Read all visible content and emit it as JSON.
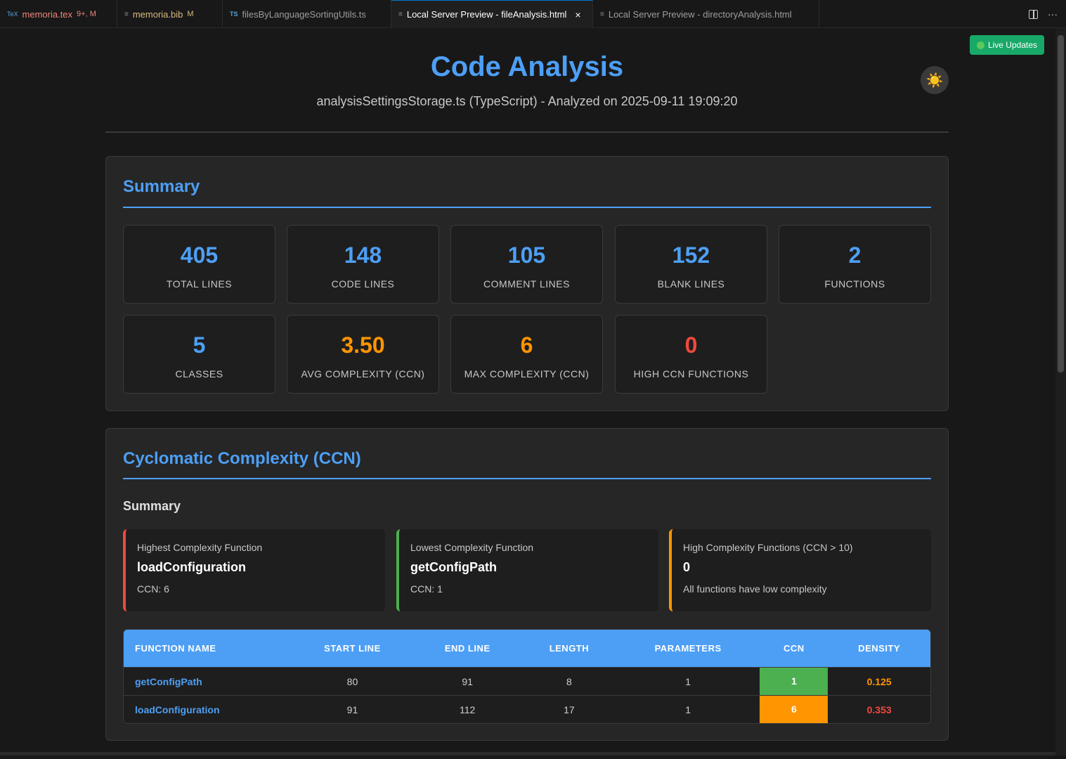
{
  "tabs": [
    {
      "icon": "TeX",
      "name": "memoria.tex",
      "modifier": "9+, M"
    },
    {
      "icon": "≡",
      "name": "memoria.bib",
      "modifier": "M"
    },
    {
      "icon": "TS",
      "name": "filesByLanguageSortingUtils.ts"
    },
    {
      "icon": "≡",
      "name": "Local Server Preview - fileAnalysis.html",
      "close": "×"
    },
    {
      "icon": "≡",
      "name": "Local Server Preview - directoryAnalysis.html"
    }
  ],
  "tab_actions": {
    "more": "···"
  },
  "live_updates": {
    "label": "Live Updates",
    "dot_color": "#5cc95c"
  },
  "theme_toggle": {
    "glyph": "☀️"
  },
  "header": {
    "title": "Code Analysis",
    "subtitle": "analysisSettingsStorage.ts (TypeScript) - Analyzed on 2025-09-11 19:09:20"
  },
  "summary": {
    "title": "Summary",
    "stats": [
      {
        "value": "405",
        "label": "TOTAL LINES",
        "color": "#4d9ff5"
      },
      {
        "value": "148",
        "label": "CODE LINES",
        "color": "#4d9ff5"
      },
      {
        "value": "105",
        "label": "COMMENT LINES",
        "color": "#4d9ff5"
      },
      {
        "value": "152",
        "label": "BLANK LINES",
        "color": "#4d9ff5"
      },
      {
        "value": "2",
        "label": "FUNCTIONS",
        "color": "#4d9ff5"
      },
      {
        "value": "5",
        "label": "CLASSES",
        "color": "#4d9ff5"
      },
      {
        "value": "3.50",
        "label": "AVG COMPLEXITY (CCN)",
        "color": "#ff9500"
      },
      {
        "value": "6",
        "label": "MAX COMPLEXITY (CCN)",
        "color": "#ff9500"
      },
      {
        "value": "0",
        "label": "HIGH CCN FUNCTIONS",
        "color": "#f0483e"
      }
    ]
  },
  "ccn": {
    "title": "Cyclomatic Complexity (CCN)",
    "summary_title": "Summary",
    "cards": [
      {
        "label": "Highest Complexity Function",
        "value": "loadConfiguration",
        "sub": "CCN: 6",
        "border": "#f0483e"
      },
      {
        "label": "Lowest Complexity Function",
        "value": "getConfigPath",
        "sub": "CCN: 1",
        "border": "#4caf50"
      },
      {
        "label": "High Complexity Functions (CCN > 10)",
        "value": "0",
        "sub": "All functions have low complexity",
        "border": "#ff9500"
      }
    ],
    "table": {
      "headers": [
        "FUNCTION NAME",
        "START LINE",
        "END LINE",
        "LENGTH",
        "PARAMETERS",
        "CCN",
        "DENSITY"
      ],
      "rows": [
        {
          "name": "getConfigPath",
          "start": "80",
          "end": "91",
          "length": "8",
          "params": "1",
          "ccn": "1",
          "density": "0.125",
          "ccn_color": "#4caf50"
        },
        {
          "name": "loadConfiguration",
          "start": "91",
          "end": "112",
          "length": "17",
          "params": "1",
          "ccn": "6",
          "density": "0.353",
          "ccn_color": "#ff9500"
        }
      ]
    }
  }
}
